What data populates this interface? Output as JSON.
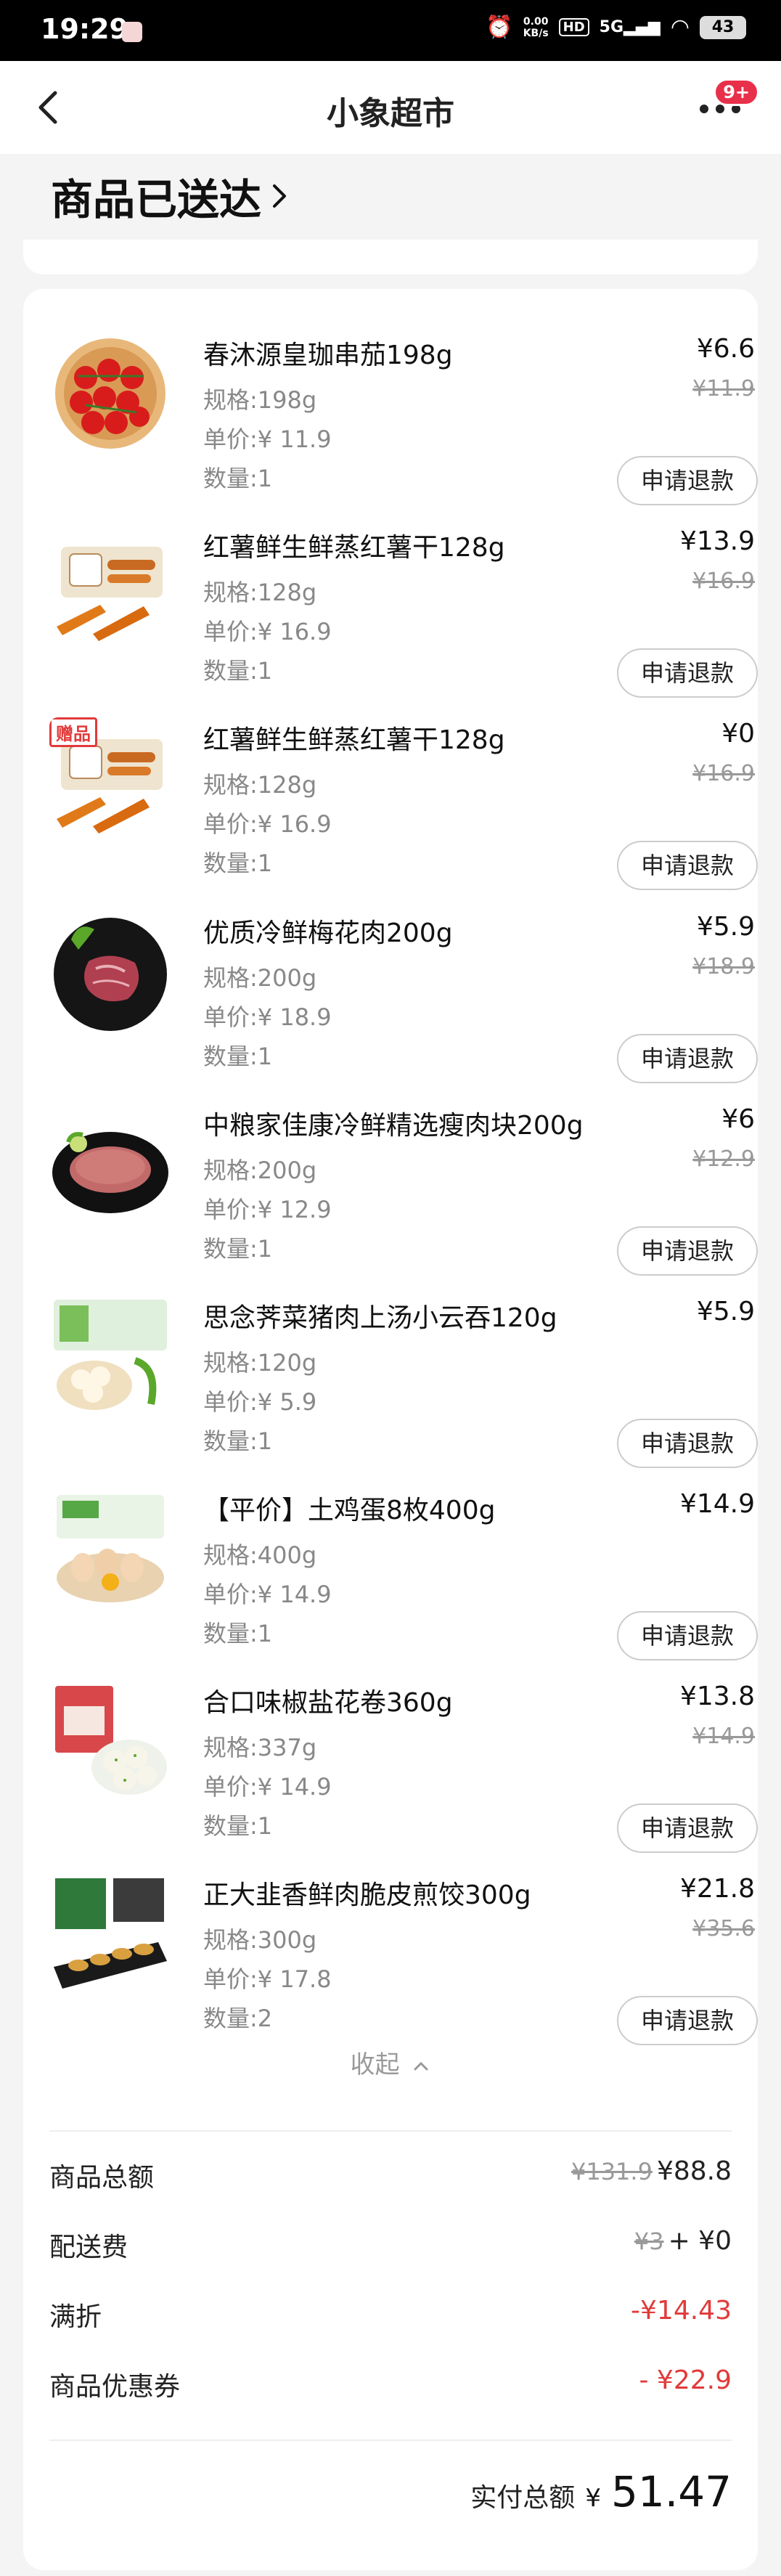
{
  "status_bar": {
    "time": "19:29",
    "netspeed_value": "0.00",
    "netspeed_unit": "KB/s",
    "hd": "HD",
    "signal": "5G",
    "battery": "43"
  },
  "nav": {
    "title": "小象超市",
    "badge": "9+"
  },
  "order_status": "商品已送达",
  "labels": {
    "spec": "规格:",
    "unit_price": "单价:",
    "quantity": "数量:",
    "refund": "申请退款",
    "gift": "赠品"
  },
  "items": [
    {
      "name": "春沐源皇珈串茄198g",
      "spec": "198g",
      "unit_price": "¥ 11.9",
      "quantity": "1",
      "price": "¥6.6",
      "original_price": "¥11.9"
    },
    {
      "name": "红薯鲜生鲜蒸红薯干128g",
      "spec": "128g",
      "unit_price": "¥ 16.9",
      "quantity": "1",
      "price": "¥13.9",
      "original_price": "¥16.9"
    },
    {
      "name": "红薯鲜生鲜蒸红薯干128g",
      "spec": "128g",
      "unit_price": "¥ 16.9",
      "quantity": "1",
      "price": "¥0",
      "original_price": "¥16.9",
      "gift": true
    },
    {
      "name": "优质冷鲜梅花肉200g",
      "spec": "200g",
      "unit_price": "¥ 18.9",
      "quantity": "1",
      "price": "¥5.9",
      "original_price": "¥18.9"
    },
    {
      "name": "中粮家佳康冷鲜精选瘦肉块200g",
      "spec": "200g",
      "unit_price": "¥ 12.9",
      "quantity": "1",
      "price": "¥6",
      "original_price": "¥12.9"
    },
    {
      "name": "思念荠菜猪肉上汤小云吞120g",
      "spec": "120g",
      "unit_price": "¥ 5.9",
      "quantity": "1",
      "price": "¥5.9",
      "original_price": ""
    },
    {
      "name": "【平价】土鸡蛋8枚400g",
      "spec": "400g",
      "unit_price": "¥ 14.9",
      "quantity": "1",
      "price": "¥14.9",
      "original_price": ""
    },
    {
      "name": "合口味椒盐花卷360g",
      "spec": "337g",
      "unit_price": "¥ 14.9",
      "quantity": "1",
      "price": "¥13.8",
      "original_price": "¥14.9"
    },
    {
      "name": "正大韭香鲜肉脆皮煎饺300g",
      "spec": "300g",
      "unit_price": "¥ 17.8",
      "quantity": "2",
      "price": "¥21.8",
      "original_price": "¥35.6"
    }
  ],
  "collapse_label": "收起",
  "summary": {
    "goods_total": {
      "label": "商品总额",
      "original": "¥131.9",
      "value": "¥88.8"
    },
    "delivery": {
      "label": "配送费",
      "original": "¥3",
      "value": "+ ¥0"
    },
    "discount": {
      "label": "满折",
      "value": "-¥14.43"
    },
    "coupon": {
      "label": "商品优惠券",
      "value": "- ¥22.9"
    }
  },
  "paid_total": {
    "label": "实付总额",
    "currency": "¥",
    "amount": "51.47"
  },
  "colors": {
    "accent_red": "#e23a3a",
    "badge_red": "#e8304a",
    "background": "#f4f4f4"
  },
  "icons": {
    "back": "chevron-left-icon",
    "more": "more-dots-icon",
    "status_arrow": "chevron-right-icon",
    "collapse_arrow": "chevron-up-icon"
  }
}
